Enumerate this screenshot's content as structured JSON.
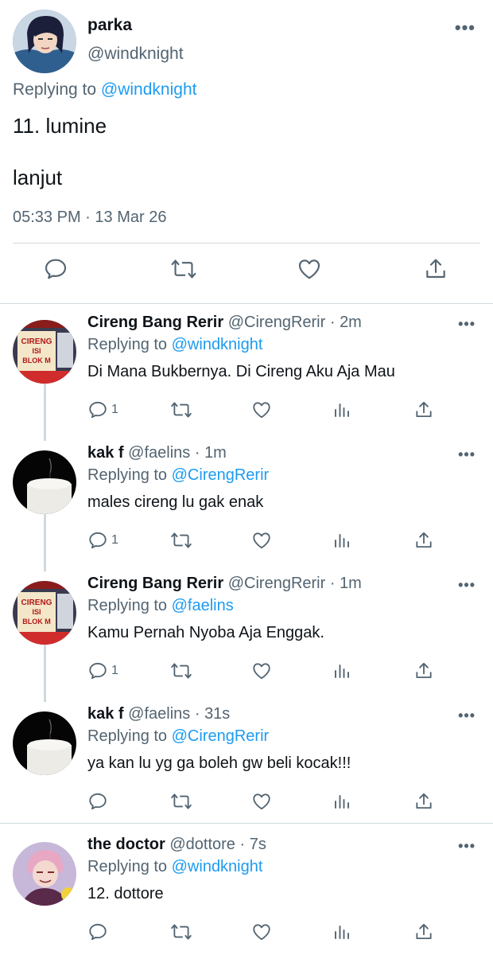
{
  "main_tweet": {
    "name": "parka",
    "handle": "@windknight",
    "replying_prefix": "Replying to ",
    "replying_to": "@windknight",
    "text_line1": "11. lumine",
    "text_line2": "lanjut",
    "time": "05:33 PM",
    "date": "13 Mar 26",
    "meta_sep": " · "
  },
  "replies": [
    {
      "name": "Cireng Bang Rerir",
      "handle": "@CirengRerir",
      "time": "2m",
      "replying_prefix": "Replying to ",
      "replying_to": "@windknight",
      "text": "Di Mana Bukbernya. Di Cireng Aku Aja Mau",
      "reply_count": "1",
      "avatar_sign": "CIRENG ISI BLOK M"
    },
    {
      "name": "kak f",
      "handle": "@faelins",
      "time": "1m",
      "replying_prefix": "Replying to ",
      "replying_to": "@CirengRerir",
      "text": "males cireng lu gak enak",
      "reply_count": "1"
    },
    {
      "name": "Cireng Bang Rerir",
      "handle": "@CirengRerir",
      "time": "1m",
      "replying_prefix": "Replying to ",
      "replying_to": "@faelins",
      "text": "Kamu Pernah Nyoba Aja Enggak.",
      "reply_count": "1",
      "avatar_sign": "CIRENG ISI BLOK M"
    },
    {
      "name": "kak f",
      "handle": "@faelins",
      "time": "31s",
      "replying_prefix": "Replying to ",
      "replying_to": "@CirengRerir",
      "text": "ya kan lu yg ga boleh gw beli kocak!!!",
      "reply_count": ""
    },
    {
      "name": "the doctor",
      "handle": "@dottore",
      "time": "7s",
      "replying_prefix": "Replying to ",
      "replying_to": "@windknight",
      "text": "12. dottore",
      "reply_count": ""
    }
  ],
  "icons": {
    "reply": "reply-icon",
    "retweet": "retweet-icon",
    "like": "like-icon",
    "share": "share-icon",
    "analytics": "analytics-icon",
    "more": "more-icon"
  },
  "colors": {
    "link": "#1d9bf0",
    "secondary": "#536471",
    "text": "#0f1419"
  }
}
